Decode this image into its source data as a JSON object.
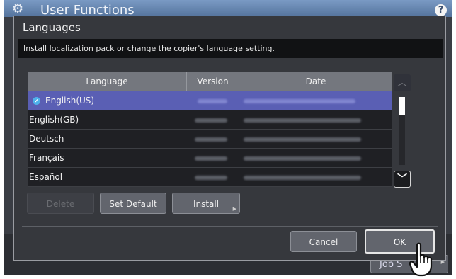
{
  "app": {
    "title": "User Functions",
    "help_label": "?",
    "bg_button_label": "Job S"
  },
  "dialog": {
    "title": "Languages",
    "message": "Install localization pack or change the copier's language setting."
  },
  "table": {
    "columns": [
      "Language",
      "Version",
      "Date"
    ],
    "rows": [
      {
        "language": "English(US)",
        "selected": true
      },
      {
        "language": "English(GB)",
        "selected": false
      },
      {
        "language": "Deutsch",
        "selected": false
      },
      {
        "language": "Français",
        "selected": false
      },
      {
        "language": "Español",
        "selected": false
      }
    ]
  },
  "buttons": {
    "delete": "Delete",
    "set_default": "Set Default",
    "install": "Install",
    "cancel": "Cancel",
    "ok": "OK"
  },
  "icons": {
    "settings": "gear-icon",
    "help": "help-icon",
    "selected": "checkmark-icon",
    "scroll_up": "chevron-up-icon",
    "scroll_down": "chevron-down-icon",
    "pointer": "hand-pointer-icon"
  },
  "colors": {
    "header": "#6a8ab3",
    "selected_row": "#5a5fb4",
    "check": "#4fb1ea"
  }
}
